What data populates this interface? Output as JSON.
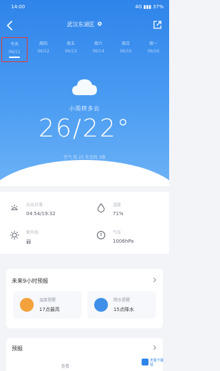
{
  "status_bar": {
    "left": "14:00",
    "right": "4G ▮▮▮ 37%"
  },
  "header": {
    "city": "武汉东湖区"
  },
  "day_tabs": [
    {
      "label": "今天",
      "date": "06/11"
    },
    {
      "label": "周四",
      "date": "06/12"
    },
    {
      "label": "周五",
      "date": "06/13"
    },
    {
      "label": "周六",
      "date": "06/14"
    },
    {
      "label": "周日",
      "date": "06/15"
    },
    {
      "label": "周一",
      "date": "06/16"
    }
  ],
  "current": {
    "condition": "小雨转多云",
    "temperature": "26/22°",
    "subline": "空气 优 25   东北风 3级"
  },
  "metrics": [
    {
      "label": "日出日落",
      "value": "04:54/19:32",
      "icon": "sunrise-icon"
    },
    {
      "label": "湿度",
      "value": "71%",
      "icon": "humidity-drop-icon"
    },
    {
      "label": "紫外线",
      "value": "弱",
      "icon": "uv-sun-icon"
    },
    {
      "label": "气压",
      "value": "1006hPa",
      "icon": "pressure-gauge-icon"
    }
  ],
  "advice": {
    "title": "未来9小时预报",
    "cards": [
      {
        "title": "温度提醒",
        "value": "17点最高",
        "icon": "temperature-icon",
        "color": "#f4a23c"
      },
      {
        "title": "降水提醒",
        "value": "15点降水",
        "icon": "rain-cloud-icon",
        "color": "#3f8fe8"
      }
    ]
  },
  "section2": {
    "title": "预报",
    "text": "查看"
  },
  "colors": {
    "primary": "#2f84ea",
    "selected_border": "#e53935"
  },
  "watermark": {
    "line1": "天极下载站",
    "line2": ""
  }
}
